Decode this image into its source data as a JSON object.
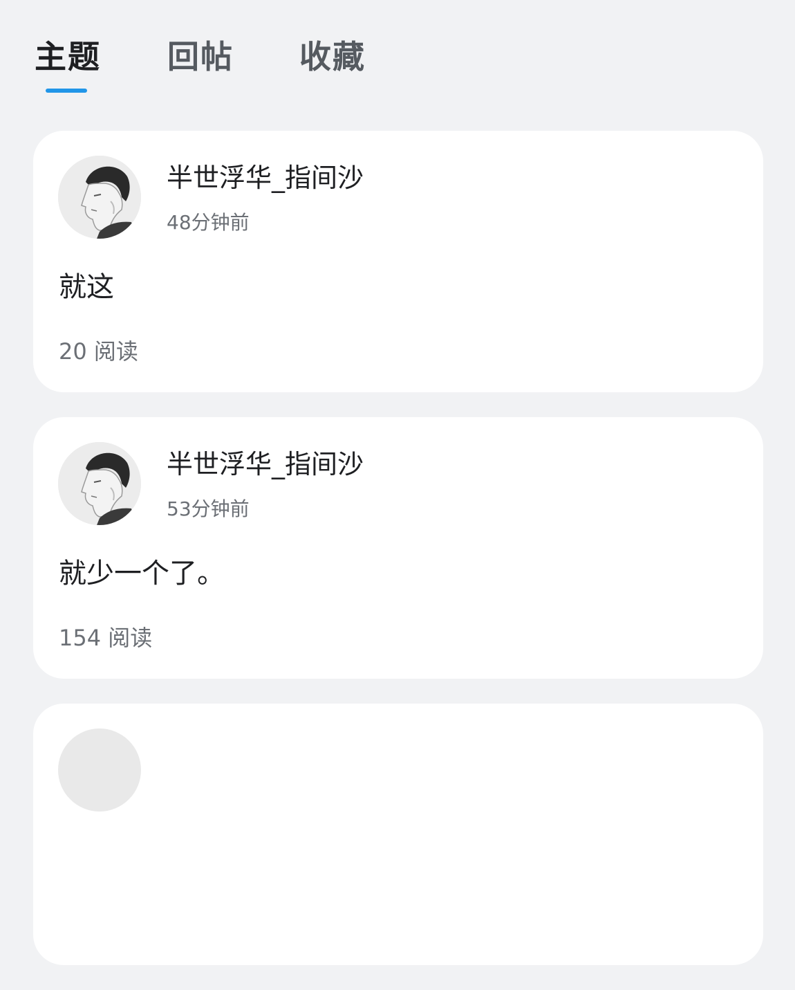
{
  "tabs": [
    {
      "label": "主题",
      "active": true
    },
    {
      "label": "回帖",
      "active": false
    },
    {
      "label": "收藏",
      "active": false
    }
  ],
  "colors": {
    "accent": "#2196e8",
    "background": "#f1f2f4",
    "card": "#ffffff"
  },
  "posts": [
    {
      "author": "半世浮华_指间沙",
      "time": "48分钟前",
      "text": "就这",
      "reads": "20 阅读",
      "avatar_icon": "user-avatar-icon"
    },
    {
      "author": "半世浮华_指间沙",
      "time": "53分钟前",
      "text": "就少一个了。",
      "reads": "154 阅读",
      "avatar_icon": "user-avatar-icon"
    },
    {
      "author": "",
      "time": "",
      "text": "",
      "reads": "",
      "avatar_icon": "user-avatar-icon"
    }
  ]
}
